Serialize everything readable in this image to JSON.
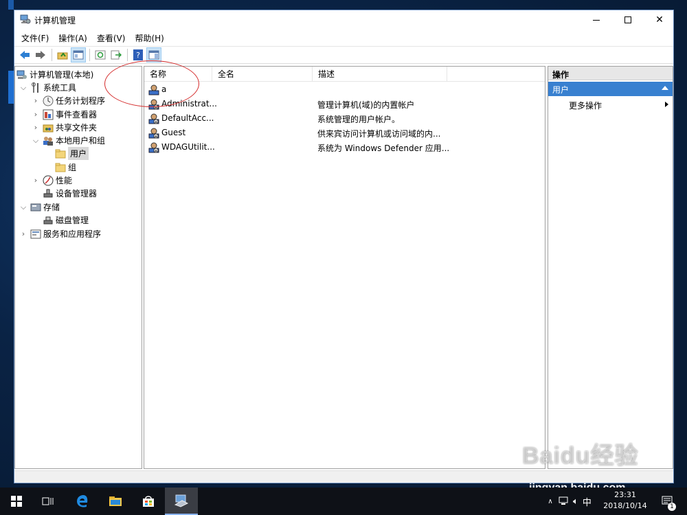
{
  "window": {
    "title": "计算机管理"
  },
  "menu": [
    "文件(F)",
    "操作(A)",
    "查看(V)",
    "帮助(H)"
  ],
  "tree": {
    "root": "计算机管理(本地)",
    "system_tools": "系统工具",
    "task_scheduler": "任务计划程序",
    "event_viewer": "事件查看器",
    "shared_folders": "共享文件夹",
    "local_users_groups": "本地用户和组",
    "users": "用户",
    "groups": "组",
    "performance": "性能",
    "device_manager": "设备管理器",
    "storage": "存储",
    "disk_management": "磁盘管理",
    "services_apps": "服务和应用程序"
  },
  "list": {
    "columns": [
      "名称",
      "全名",
      "描述"
    ],
    "rows": [
      {
        "name": "a",
        "fullname": "",
        "description": ""
      },
      {
        "name": "Administrat...",
        "fullname": "",
        "description": "管理计算机(域)的内置帐户"
      },
      {
        "name": "DefaultAcc...",
        "fullname": "",
        "description": "系统管理的用户帐户。"
      },
      {
        "name": "Guest",
        "fullname": "",
        "description": "供来宾访问计算机或访问域的内..."
      },
      {
        "name": "WDAGUtilit...",
        "fullname": "",
        "description": "系统为 Windows Defender 应用..."
      }
    ]
  },
  "actions": {
    "header": "操作",
    "section": "用户",
    "more": "更多操作"
  },
  "taskbar": {
    "time": "23:31",
    "date": "2018/10/14",
    "ime": "中",
    "notifications": "1"
  },
  "watermark": {
    "brand": "Baidu经验",
    "url": "jingyan.baidu.com"
  },
  "colors": {
    "selection_blue": "#3880d0",
    "annotation_red": "#d42a2a",
    "taskbar": "#0e1117"
  }
}
